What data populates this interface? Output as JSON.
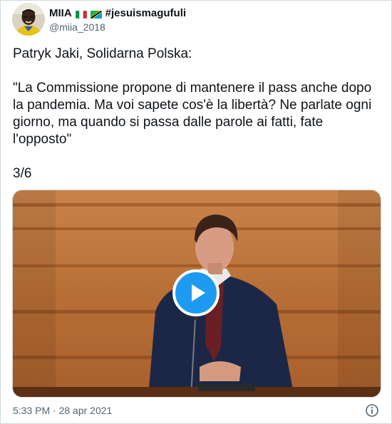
{
  "author": {
    "display_name": "MIIA",
    "flags": [
      "italy-flag",
      "tanzania-flag"
    ],
    "hashtag": "#jesuismagufuli",
    "handle": "@miia_2018"
  },
  "tweet": {
    "text": "Patryk Jaki, Solidarna Polska:\n\n\"La Commissione propone di mantenere il pass anche dopo la pandemia. Ma voi sapete cos'è la libertà? Ne parlate ogni giorno, ma quando si passa dalle parole ai fatti, fate l'opposto\"\n\n3/6",
    "timestamp": "5:33 PM · 28 apr 2021"
  },
  "media": {
    "type": "video",
    "play_icon": "play-icon"
  },
  "icons": {
    "info": "info-icon"
  },
  "colors": {
    "accent": "#1d9bf0",
    "secondary_text": "#536471",
    "border": "#cfd9de"
  }
}
